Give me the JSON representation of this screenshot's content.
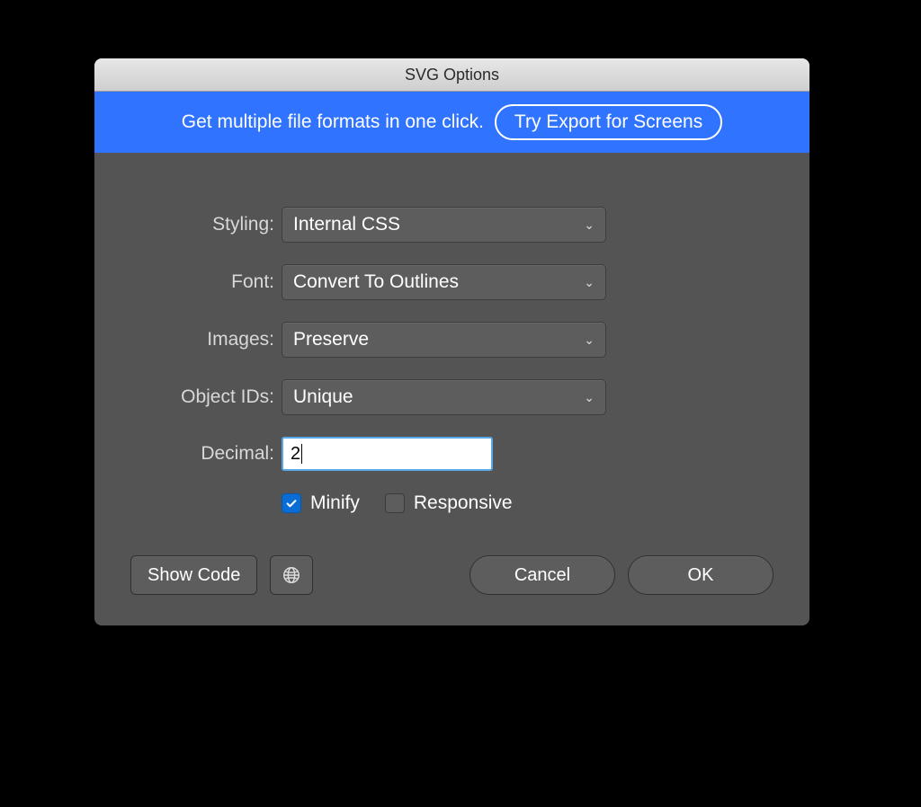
{
  "window": {
    "title": "SVG Options"
  },
  "banner": {
    "text": "Get multiple file formats in one click.",
    "cta": "Try Export for Screens"
  },
  "form": {
    "styling": {
      "label": "Styling:",
      "value": "Internal CSS"
    },
    "font": {
      "label": "Font:",
      "value": "Convert To Outlines"
    },
    "images": {
      "label": "Images:",
      "value": "Preserve"
    },
    "objectIds": {
      "label": "Object IDs:",
      "value": "Unique"
    },
    "decimal": {
      "label": "Decimal:",
      "value": "2"
    },
    "minify": {
      "label": "Minify",
      "checked": true
    },
    "responsive": {
      "label": "Responsive",
      "checked": false
    }
  },
  "footer": {
    "showCode": "Show Code",
    "cancel": "Cancel",
    "ok": "OK"
  }
}
